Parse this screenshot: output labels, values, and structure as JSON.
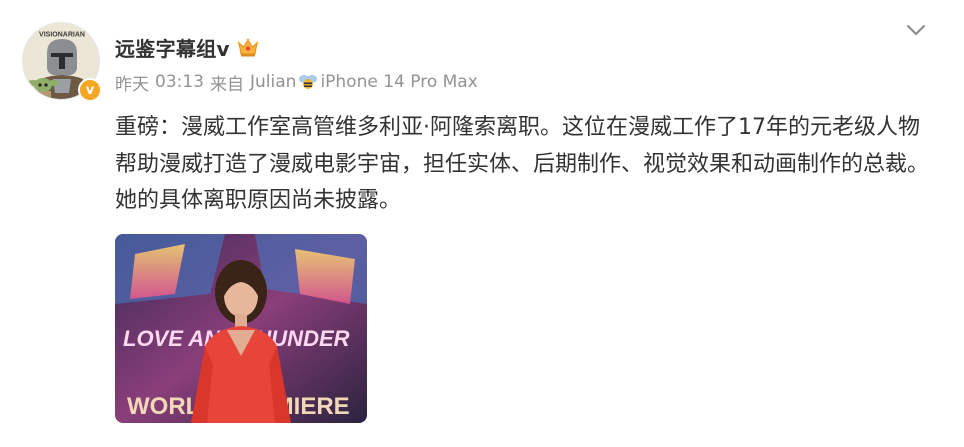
{
  "post": {
    "author": {
      "name": "远鉴字幕组v",
      "avatar_icon": "mandalorian-avatar",
      "avatar_caption": "VISIONARIAN",
      "verified_badge_glyph": "v",
      "verified_color": "#f5a623",
      "vip_icon": "crown-icon"
    },
    "meta": {
      "date": "昨天",
      "time": "03:13",
      "source_prefix": "来自",
      "source_name": "Julian",
      "source_icon": "bee-icon",
      "source_device": "iPhone 14 Pro Max"
    },
    "more_icon": "chevron-down-icon",
    "text": "重磅：漫威工作室高管维多利亚·阿隆索离职。这位在漫威工作了17年的元老级人物帮助漫威打造了漫威电影宇宙，担任实体、后期制作、视觉效果和动画制作的总裁。她的具体离职原因尚未披露。",
    "image": {
      "backdrop_top": "LOVE AND THUNDER",
      "backdrop_bottom": "WORLD PREMIERE"
    }
  },
  "colors": {
    "text": "#333333",
    "meta": "#939393",
    "accent_orange": "#f5a623",
    "dress_red": "#e8453a"
  }
}
